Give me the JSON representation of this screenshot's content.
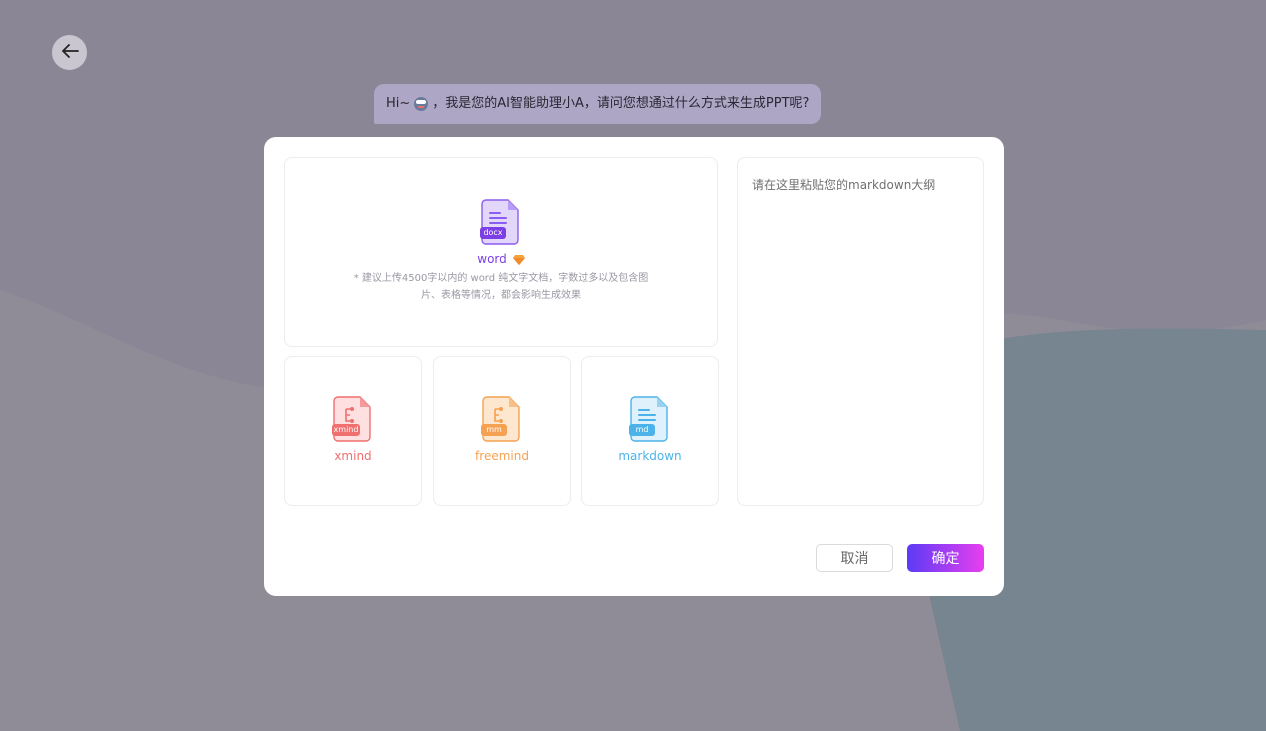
{
  "chat": {
    "before": "Hi~",
    "after": "，我是您的AI智能助理小A，请问您想通过什么方式来生成PPT呢?"
  },
  "upload": {
    "word": {
      "badge": "docx",
      "label": "word",
      "hint": "* 建议上传4500字以内的 word 纯文字文档，字数过多以及包含图片、表格等情况，都会影响生成效果",
      "color": "#7b3fe4"
    },
    "xmind": {
      "badge": "xmind",
      "label": "xmind",
      "color": "#f06f6f"
    },
    "freemind": {
      "badge": "mm",
      "label": "freemind",
      "color": "#f5a151"
    },
    "markdown": {
      "badge": "md",
      "label": "markdown",
      "color": "#4bb3ea"
    }
  },
  "editor": {
    "placeholder": "请在这里粘贴您的markdown大纲"
  },
  "actions": {
    "cancel": "取消",
    "confirm": "确定"
  },
  "icons": {
    "back": "arrow-left-icon",
    "robot": "robot-emoji-icon",
    "gem": "gem-icon",
    "doc": "document-icon",
    "mindmap": "mindmap-icon"
  },
  "colors": {
    "accent_start": "#5b3cf5",
    "accent_end": "#e83ef0"
  }
}
